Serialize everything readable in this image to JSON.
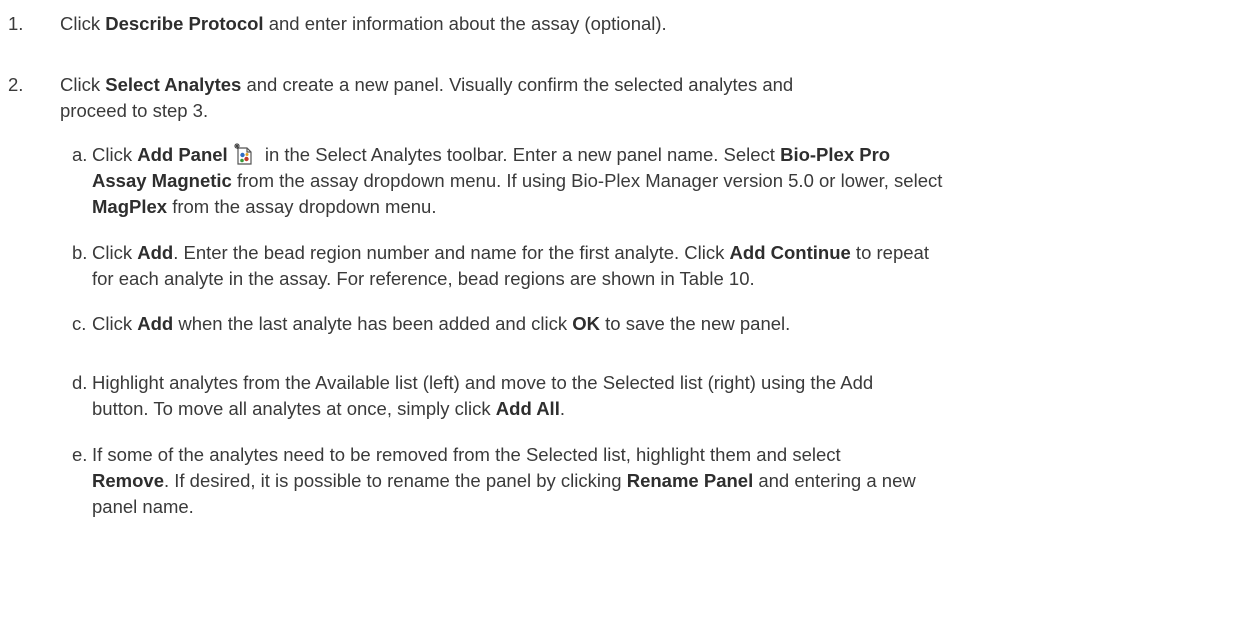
{
  "steps": [
    {
      "number": "1.",
      "parts": {
        "p1": "Click ",
        "b1": "Describe Protocol",
        "p2": " and enter information about the assay (optional)."
      }
    },
    {
      "number": "2.",
      "line1": {
        "p1": "Click ",
        "b1": "Select Analytes",
        "p2": " and create a new panel. Visually confirm the selected analytes and"
      },
      "line2": "proceed to step 3.",
      "substeps": [
        {
          "letter": "a.",
          "line1": {
            "p1": "Click ",
            "b1": "Add Panel",
            "p2": " in the Select Analytes toolbar. Enter a new panel name. Select ",
            "b2": "Bio-Plex Pro"
          },
          "line2": {
            "b1": "Assay Magnetic",
            "p1": " from the assay dropdown menu. If using Bio-Plex Manager version 5.0 or lower, select"
          },
          "line3": {
            "b1": "MagPlex",
            "p1": " from the assay dropdown menu."
          },
          "icon": "add-panel-icon"
        },
        {
          "letter": "b.",
          "line1": {
            "p1": "Click ",
            "b1": "Add",
            "p2": ". Enter the bead region number and name for the first analyte. Click ",
            "b2": "Add Continue",
            "p3": " to repeat"
          },
          "line2": "for each analyte in the assay. For reference, bead regions are shown in Table 10."
        },
        {
          "letter": "c.",
          "line1": {
            "p1": "Click ",
            "b1": "Add",
            "p2": " when the last analyte has been added and click ",
            "b2": "OK",
            "p3": " to save the new panel."
          }
        },
        {
          "letter": "d.",
          "line1": "Highlight analytes from the Available list (left) and move to the Selected list (right) using the Add",
          "line2": {
            "p1": "button. To move all analytes at once, simply click ",
            "b1": "Add All",
            "p2": "."
          }
        },
        {
          "letter": "e.",
          "line1": "If some of the analytes need to be removed from the Selected list, highlight them and select",
          "line2": {
            "b1": "Remove",
            "p1": ". If desired, it is possible to rename the panel by clicking ",
            "b2": "Rename Panel",
            "p2": " and entering a new"
          },
          "line3": "panel name."
        }
      ]
    }
  ]
}
